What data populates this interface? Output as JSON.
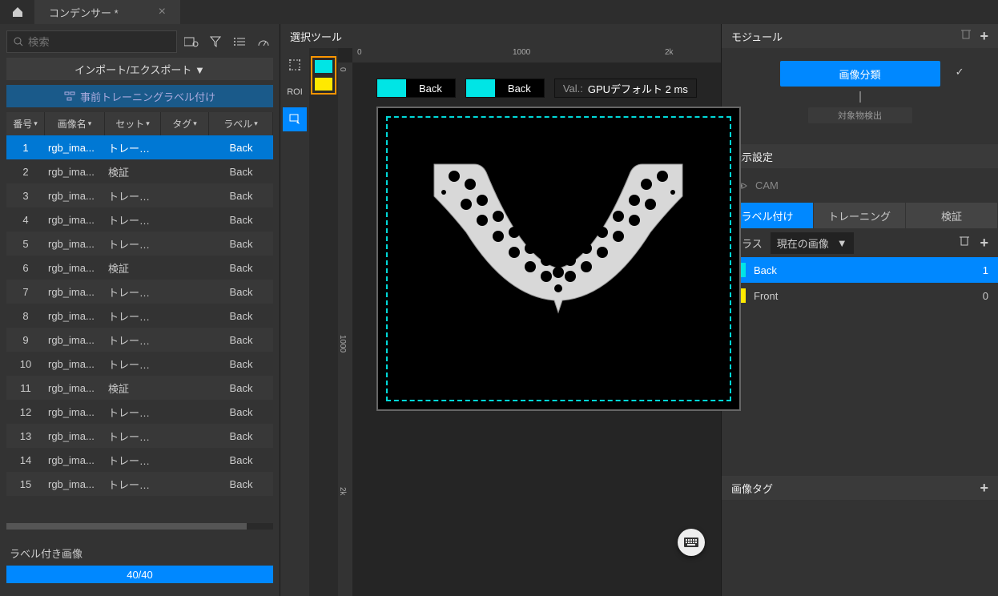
{
  "topbar": {
    "tab_title": "コンデンサー *"
  },
  "left": {
    "search_placeholder": "検索",
    "import_export": "インポート/エクスポート ▼",
    "pretrain_label": "事前トレーニングラベル付け",
    "columns": {
      "no": "番号",
      "name": "画像名",
      "set": "セット",
      "tag": "タグ",
      "label": "ラベル"
    },
    "rows": [
      {
        "no": 1,
        "name": "rgb_ima...",
        "set": "トレーニ...",
        "tag": "",
        "label": "Back",
        "selected": true
      },
      {
        "no": 2,
        "name": "rgb_ima...",
        "set": "検証",
        "tag": "",
        "label": "Back"
      },
      {
        "no": 3,
        "name": "rgb_ima...",
        "set": "トレーニ...",
        "tag": "",
        "label": "Back"
      },
      {
        "no": 4,
        "name": "rgb_ima...",
        "set": "トレーニ...",
        "tag": "",
        "label": "Back"
      },
      {
        "no": 5,
        "name": "rgb_ima...",
        "set": "トレーニ...",
        "tag": "",
        "label": "Back"
      },
      {
        "no": 6,
        "name": "rgb_ima...",
        "set": "検証",
        "tag": "",
        "label": "Back"
      },
      {
        "no": 7,
        "name": "rgb_ima...",
        "set": "トレーニ...",
        "tag": "",
        "label": "Back"
      },
      {
        "no": 8,
        "name": "rgb_ima...",
        "set": "トレーニ...",
        "tag": "",
        "label": "Back"
      },
      {
        "no": 9,
        "name": "rgb_ima...",
        "set": "トレーニ...",
        "tag": "",
        "label": "Back"
      },
      {
        "no": 10,
        "name": "rgb_ima...",
        "set": "トレーニ...",
        "tag": "",
        "label": "Back"
      },
      {
        "no": 11,
        "name": "rgb_ima...",
        "set": "検証",
        "tag": "",
        "label": "Back"
      },
      {
        "no": 12,
        "name": "rgb_ima...",
        "set": "トレーニ...",
        "tag": "",
        "label": "Back"
      },
      {
        "no": 13,
        "name": "rgb_ima...",
        "set": "トレーニ...",
        "tag": "",
        "label": "Back"
      },
      {
        "no": 14,
        "name": "rgb_ima...",
        "set": "トレーニ...",
        "tag": "",
        "label": "Back"
      },
      {
        "no": 15,
        "name": "rgb_ima...",
        "set": "トレーニ...",
        "tag": "",
        "label": "Back"
      }
    ],
    "progress_label": "ラベル付き画像",
    "progress_text": "40/40",
    "progress_percent": 100
  },
  "center": {
    "header": "選択ツール",
    "ruler_ticks_h": [
      "0",
      "1000",
      "2k"
    ],
    "ruler_ticks_v": [
      "0",
      "1000",
      "2k"
    ],
    "badge1": {
      "color": "#00e5e5",
      "label": "Back"
    },
    "badge2": {
      "color": "#00e5e5",
      "label": "Back"
    },
    "info_prefix": "Val.:",
    "info_value": "GPUデフォルト 2 ms",
    "palette": [
      "#00e5e5",
      "#ffe900"
    ]
  },
  "right": {
    "module_header": "モジュール",
    "module_node": "画像分類",
    "module_node2": "対象物検出",
    "display_header": "表示設定",
    "cam_label": "CAM",
    "tabs": {
      "label": "ラベル付け",
      "train": "トレーニング",
      "val": "検証"
    },
    "class_label": "クラス",
    "class_dropdown": "現在の画像",
    "classes": [
      {
        "name": "Back",
        "color": "#00e5e5",
        "count": 1,
        "selected": true
      },
      {
        "name": "Front",
        "color": "#ffe900",
        "count": 0
      }
    ],
    "tags_header": "画像タグ"
  }
}
